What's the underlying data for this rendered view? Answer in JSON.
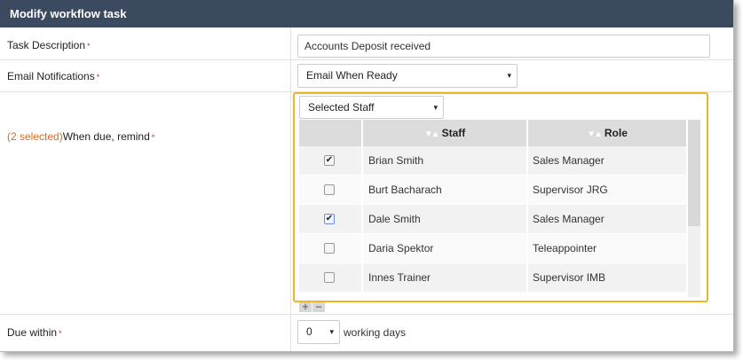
{
  "dialog": {
    "title": "Modify workflow task"
  },
  "fields": {
    "task_description": {
      "label": "Task Description",
      "value": "Accounts Deposit received"
    },
    "email_notifications": {
      "label": "Email Notifications",
      "value": "Email When Ready"
    },
    "reminder": {
      "selected_count": "(2 selected)",
      "label": "When due, remind",
      "filter_value": "Selected Staff"
    },
    "due_within": {
      "label": "Due within",
      "value": "0",
      "unit": "working days"
    }
  },
  "required_marker": "*",
  "icons": {
    "dropdown": "▾",
    "sort": "▼▲",
    "check": "✔",
    "add": "+",
    "remove": "−"
  },
  "staff_table": {
    "columns": [
      "Staff",
      "Role"
    ],
    "rows": [
      {
        "staff": "Brian Smith",
        "role": "Sales Manager",
        "checked": true
      },
      {
        "staff": "Burt Bacharach",
        "role": "Supervisor JRG",
        "checked": false
      },
      {
        "staff": "Dale Smith",
        "role": "Sales Manager",
        "checked": true
      },
      {
        "staff": "Daria Spektor",
        "role": "Teleappointer",
        "checked": false
      },
      {
        "staff": "Innes Trainer",
        "role": "Supervisor IMB",
        "checked": false
      }
    ]
  },
  "colors": {
    "titlebar": "#3b4a5f",
    "highlight_border": "#f0b429",
    "required": "#d0301e",
    "selected_count": "#e06a1f"
  }
}
